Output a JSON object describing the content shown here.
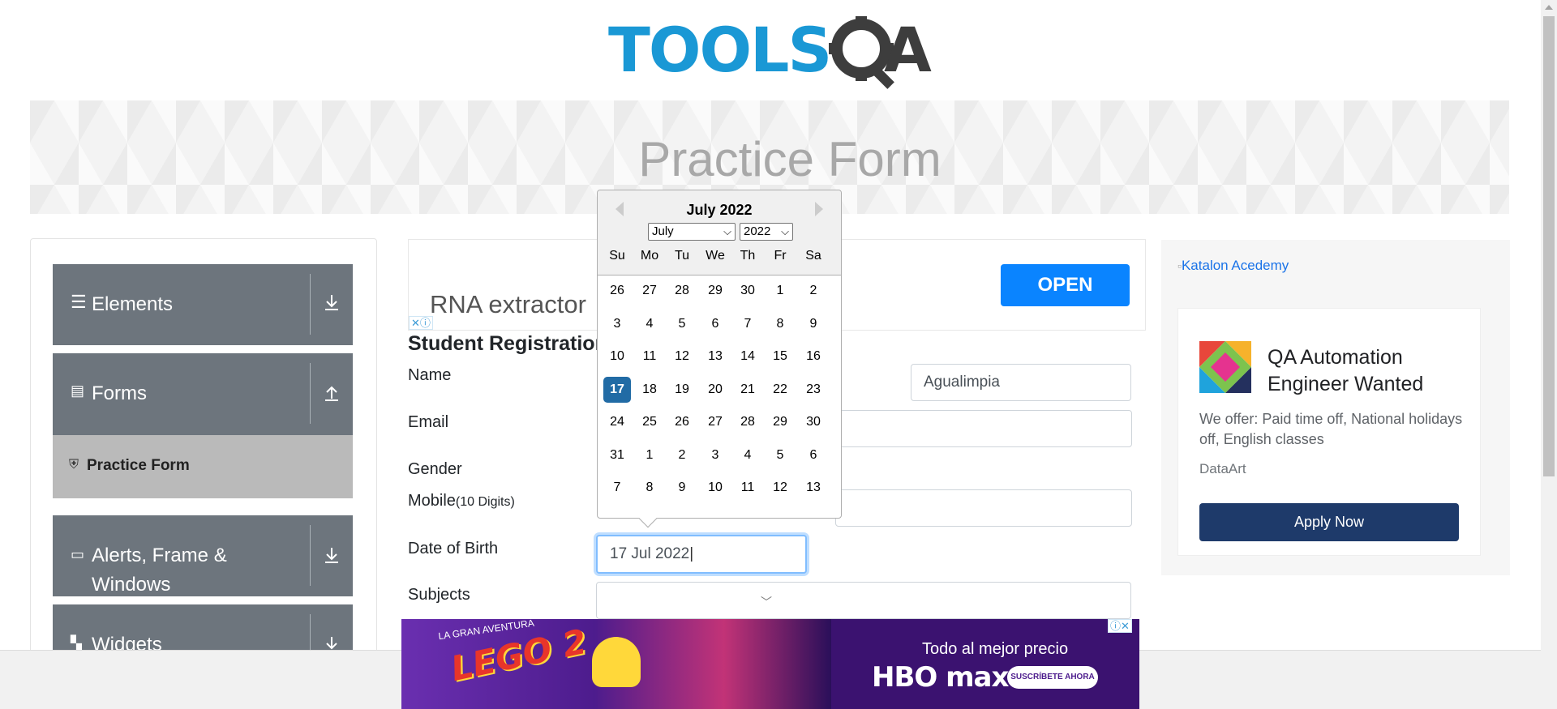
{
  "logo": {
    "text_tools": "TOOLS",
    "text_qa": "QA"
  },
  "banner": {
    "title": "Practice Form"
  },
  "sidebar": {
    "groups": [
      {
        "label": "Elements",
        "icon": "hamburger-icon",
        "arrow": "download-arrow-icon"
      },
      {
        "label": "Forms",
        "icon": "document-icon",
        "arrow": "upload-arrow-icon"
      },
      {
        "label": "Alerts, Frame &",
        "label2": "Windows",
        "icon": "window-icon",
        "arrow": "download-arrow-icon"
      },
      {
        "label": "Widgets",
        "icon": "widgets-icon",
        "arrow": "download-arrow-icon"
      }
    ],
    "active_item": {
      "label": "Practice Form",
      "icon": "html5-icon"
    }
  },
  "ad_top": {
    "text": "RNA extractor",
    "button": "OPEN"
  },
  "form": {
    "title": "Student Registration",
    "labels": {
      "name": "Name",
      "email": "Email",
      "gender": "Gender",
      "mobile": "Mobile",
      "mobile_hint": "(10 Digits)",
      "dob": "Date of Birth",
      "subjects": "Subjects"
    },
    "last_name_value": "Agualimpia",
    "dob_value": "17 Jul 2022"
  },
  "datepicker": {
    "month_year": "July 2022",
    "month_select": "July",
    "year_select": "2022",
    "day_names": [
      "Su",
      "Mo",
      "Tu",
      "We",
      "Th",
      "Fr",
      "Sa"
    ],
    "weeks": [
      [
        "26",
        "27",
        "28",
        "29",
        "30",
        "1",
        "2"
      ],
      [
        "3",
        "4",
        "5",
        "6",
        "7",
        "8",
        "9"
      ],
      [
        "10",
        "11",
        "12",
        "13",
        "14",
        "15",
        "16"
      ],
      [
        "17",
        "18",
        "19",
        "20",
        "21",
        "22",
        "23"
      ],
      [
        "24",
        "25",
        "26",
        "27",
        "28",
        "29",
        "30"
      ],
      [
        "31",
        "1",
        "2",
        "3",
        "4",
        "5",
        "6"
      ],
      [
        "7",
        "8",
        "9",
        "10",
        "11",
        "12",
        "13"
      ]
    ],
    "selected": "17"
  },
  "right_ad": {
    "broken_image_alt": "Katalon Acedemy",
    "headline_1": "QA Automation",
    "headline_2": "Engineer Wanted",
    "description": "We offer: Paid time off, National holidays off, English classes",
    "brand": "DataArt",
    "button": "Apply Now"
  },
  "bottom_ad": {
    "movie_top": "LA GRAN AVENTURA",
    "movie": "LEGO 2",
    "tagline": "Todo al mejor precio",
    "brand": "HBO max",
    "cta": "SUSCRÍBETE AHORA"
  },
  "colors": {
    "logo_blue": "#1a98d5",
    "sidebar_group": "#6d757d",
    "active_item": "#bababa",
    "datepicker_selected": "#216ba5",
    "open_button": "#0a84ff",
    "apply_button": "#1e3a6a"
  }
}
